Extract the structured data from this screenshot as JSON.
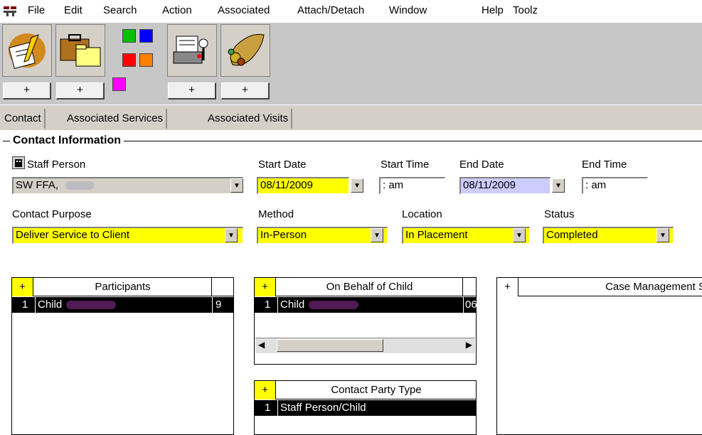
{
  "menu": [
    "File",
    "Edit",
    "Search",
    "Action",
    "Associated",
    "Attach/Detach",
    "Window",
    "Help",
    "Toolz"
  ],
  "toolbar": {
    "plus_label": "+",
    "icons": [
      "contact-notes-icon",
      "briefcase-folder-icon",
      "color-palette-icon",
      "printer-person-icon",
      "cornucopia-icon"
    ],
    "swatch_colors": [
      "#00c000",
      "#0000ff",
      "#ff0000",
      "#ff8000",
      "#ff00ff"
    ]
  },
  "tabs": [
    "Contact",
    "Associated Services",
    "Associated Visits"
  ],
  "group_title": "Contact Information",
  "fields": {
    "staff_person": {
      "label": "Staff Person",
      "value": "SW FFA,"
    },
    "start_date": {
      "label": "Start Date",
      "value": "08/11/2009"
    },
    "start_time": {
      "label": "Start Time",
      "value": " :  am"
    },
    "end_date": {
      "label": "End Date",
      "value": "08/11/2009"
    },
    "end_time": {
      "label": "End Time",
      "value": " :  am"
    },
    "contact_purpose": {
      "label": "Contact Purpose",
      "value": "Deliver Service to Client"
    },
    "method": {
      "label": "Method",
      "value": "In-Person"
    },
    "location": {
      "label": "Location",
      "value": "In Placement"
    },
    "status": {
      "label": "Status",
      "value": "Completed"
    }
  },
  "grids": {
    "participants": {
      "header": "Participants",
      "rows": [
        {
          "num": "1",
          "type": "Child",
          "extra": "9"
        }
      ]
    },
    "on_behalf": {
      "header": "On Behalf of Child",
      "rows": [
        {
          "num": "1",
          "type": "Child",
          "extra": "06"
        }
      ]
    },
    "party_type": {
      "header": "Contact Party Type",
      "rows": [
        {
          "num": "1",
          "type": "Staff Person/Child"
        }
      ]
    },
    "case_mgmt": {
      "header": "Case Management S"
    }
  },
  "colors": {
    "required": "#ffff00",
    "toolbar_bg": "#c7c7c7",
    "selected_row": "#000000"
  }
}
